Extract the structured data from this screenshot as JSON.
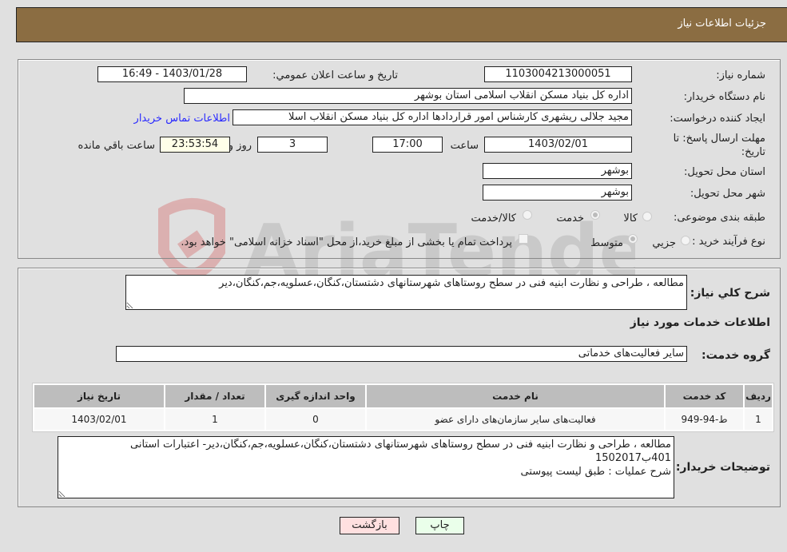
{
  "header": {
    "title": "جزئیات اطلاعات نیاز"
  },
  "details": {
    "need_number_label": "شماره نیاز:",
    "need_number": "1103004213000051",
    "announce_label": "تاریخ و ساعت اعلان عمومي:",
    "announce_value": "1403/01/28 - 16:49",
    "buyer_org_label": "نام دستگاه خریدار:",
    "buyer_org": "اداره کل بنیاد مسکن انقلاب اسلامی استان بوشهر",
    "creator_label": "ایجاد کننده درخواست:",
    "creator": "مجید جلالی ریشهری کارشناس امور قراردادها اداره کل بنیاد مسکن انقلاب اسلا",
    "contact_link": "اطلاعات تماس خریدار",
    "deadline_label": "مهلت ارسال پاسخ: تا تاریخ:",
    "deadline_date": "1403/02/01",
    "time_label": "ساعت",
    "deadline_time": "17:00",
    "days": "3",
    "days_label": "روز و",
    "remaining": "23:53:54",
    "remaining_label": "ساعت باقي مانده",
    "province_label": "استان محل تحویل:",
    "province": "بوشهر",
    "city_label": "شهر محل تحویل:",
    "city": "بوشهر",
    "category_label": "طبقه بندی موضوعی:",
    "category_options": [
      "کالا",
      "خدمت",
      "کالا/خدمت"
    ],
    "category_selected": "خدمت",
    "process_label": "نوع فرآیند خرید :",
    "process_options": [
      "جزيي",
      "متوسط"
    ],
    "process_selected": "متوسط",
    "treasury_note": "پرداخت تمام یا بخشی از مبلغ خرید،از محل \"اسناد خزانه اسلامی\" خواهد بود."
  },
  "services": {
    "summary_label": "شرح کلي نیاز:",
    "summary": "مطالعه ، طراحی و نظارت ابنیه فنی در سطح روستاهای شهرستانهای دشتستان،کنگان،عسلویه،جم،کنگان،دیر",
    "section_title": "اطلاعات خدمات مورد نیاز",
    "group_label": "گروه خدمت:",
    "group_value": "سایر فعالیت‌های خدماتی",
    "table": {
      "headers": [
        "ردیف",
        "کد خدمت",
        "نام خدمت",
        "واحد اندازه گیری",
        "تعداد / مقدار",
        "تاریخ نیاز"
      ],
      "rows": [
        [
          "1",
          "ط-94-949",
          "فعالیت‌های سایر سازمان‌های دارای عضو",
          "0",
          "1",
          "1403/02/01"
        ]
      ]
    },
    "buyer_notes_label": "توضیحات خریدار:",
    "buyer_notes": "مطالعه ، طراحی و نظارت ابنیه فنی در سطح روستاهای شهرستانهای دشتستان،کنگان،عسلویه،جم،کنگان،دیر- اعتبارات استانی 401ب1502017\nشرح عملیات : طبق لیست پیوستی"
  },
  "buttons": {
    "print": "چاپ",
    "back": "بازگشت"
  },
  "watermark": {
    "text": "AriaTender.net"
  }
}
